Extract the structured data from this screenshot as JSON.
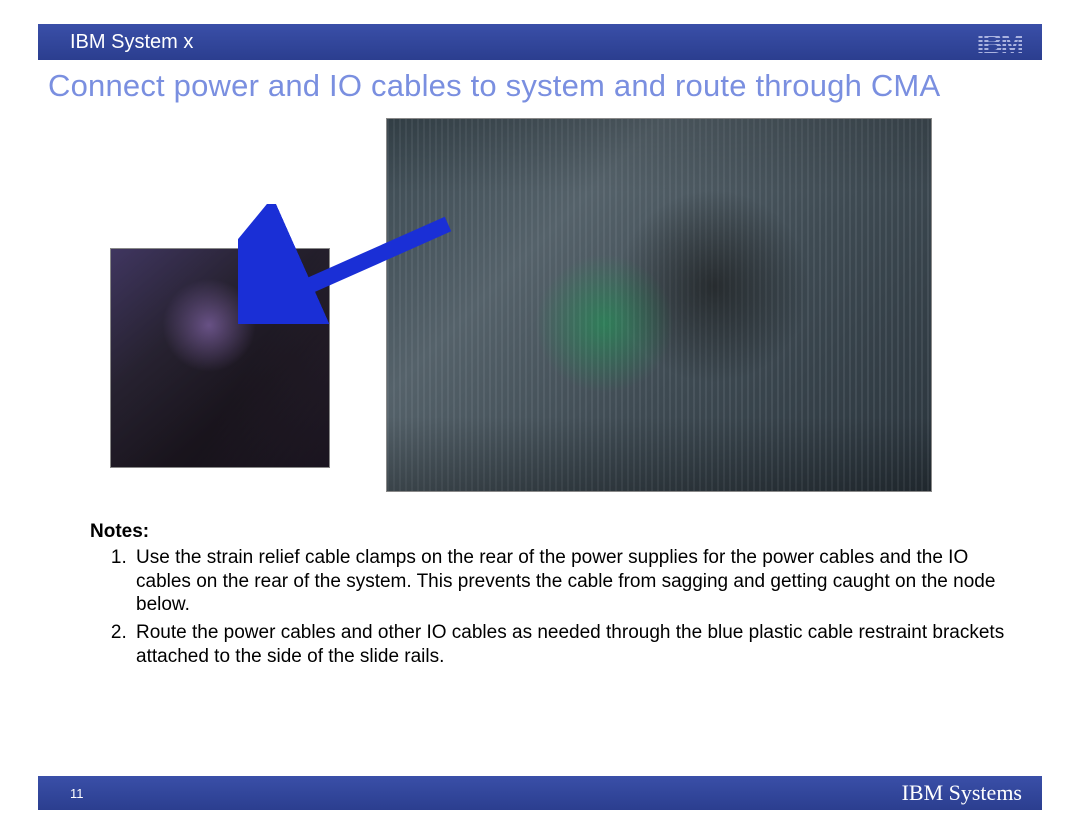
{
  "header": {
    "product_line": "IBM System x",
    "logo_text": "IBM"
  },
  "title": "Connect power and IO cables to system and route through CMA",
  "notes": {
    "heading": "Notes:",
    "items": [
      "Use the strain relief cable clamps on the rear of the power supplies for the power cables and the IO cables on the rear of the system.  This prevents the cable from sagging and getting caught on the node below.",
      "Route the power cables and other IO cables as needed through the blue plastic cable restraint brackets attached to the side of the slide rails."
    ]
  },
  "footer": {
    "page_number": "11",
    "brand": "IBM Systems"
  },
  "colors": {
    "bar": "#2b3e8f",
    "title": "#7a8fe0",
    "arrow": "#1a2fd6"
  }
}
